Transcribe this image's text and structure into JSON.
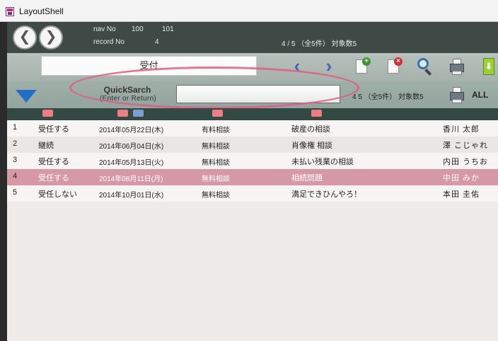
{
  "window": {
    "title": "LayoutShell"
  },
  "nav": {
    "nav_label": "nav No",
    "nav_from": "100",
    "nav_to": "101",
    "record_label": "record No",
    "record_value": "4",
    "found_text": "4 / 5 （全5件） 対象数5",
    "back_glyph": "❮",
    "forward_glyph": "❯"
  },
  "toolbar": {
    "layout_name": "受付",
    "prev_glyph": "‹",
    "next_glyph": "›",
    "new_badge": "+",
    "delete_badge": "×",
    "download_glyph": "⬇"
  },
  "search": {
    "title": "QuickSarch",
    "hint": "(Enter or Return)",
    "value": "",
    "count_text": "4 5 （全5件） 対象数5",
    "all_label": "ALL"
  },
  "colors": {
    "accent_blue": "#1f6ec8",
    "selected_row": "#d798a6",
    "annotation_red": "#e45a82"
  },
  "records": [
    {
      "no": "1",
      "status": "受任する",
      "date": "2014年05月22日(木)",
      "type": "有料相談",
      "subject": "破産の相談",
      "person": "香川 太郎"
    },
    {
      "no": "2",
      "status": "継続",
      "date": "2014年06月04日(水)",
      "type": "無料相談",
      "subject": "肖像権 相談",
      "person": "澤 こじゃれ"
    },
    {
      "no": "3",
      "status": "受任する",
      "date": "2014年05月13日(火)",
      "type": "無料相談",
      "subject": "未払い残業の相談",
      "person": "内田 うちお"
    },
    {
      "no": "4",
      "status": "受任する",
      "date": "2014年08月11日(月)",
      "type": "無料相談",
      "subject": "相続問題",
      "person": "中田 みか"
    },
    {
      "no": "5",
      "status": "受任しない",
      "date": "2014年10月01日(水)",
      "type": "無料相談",
      "subject": "満足できひんやろ！",
      "person": "本田 圭佑"
    }
  ],
  "selected_record": "4"
}
